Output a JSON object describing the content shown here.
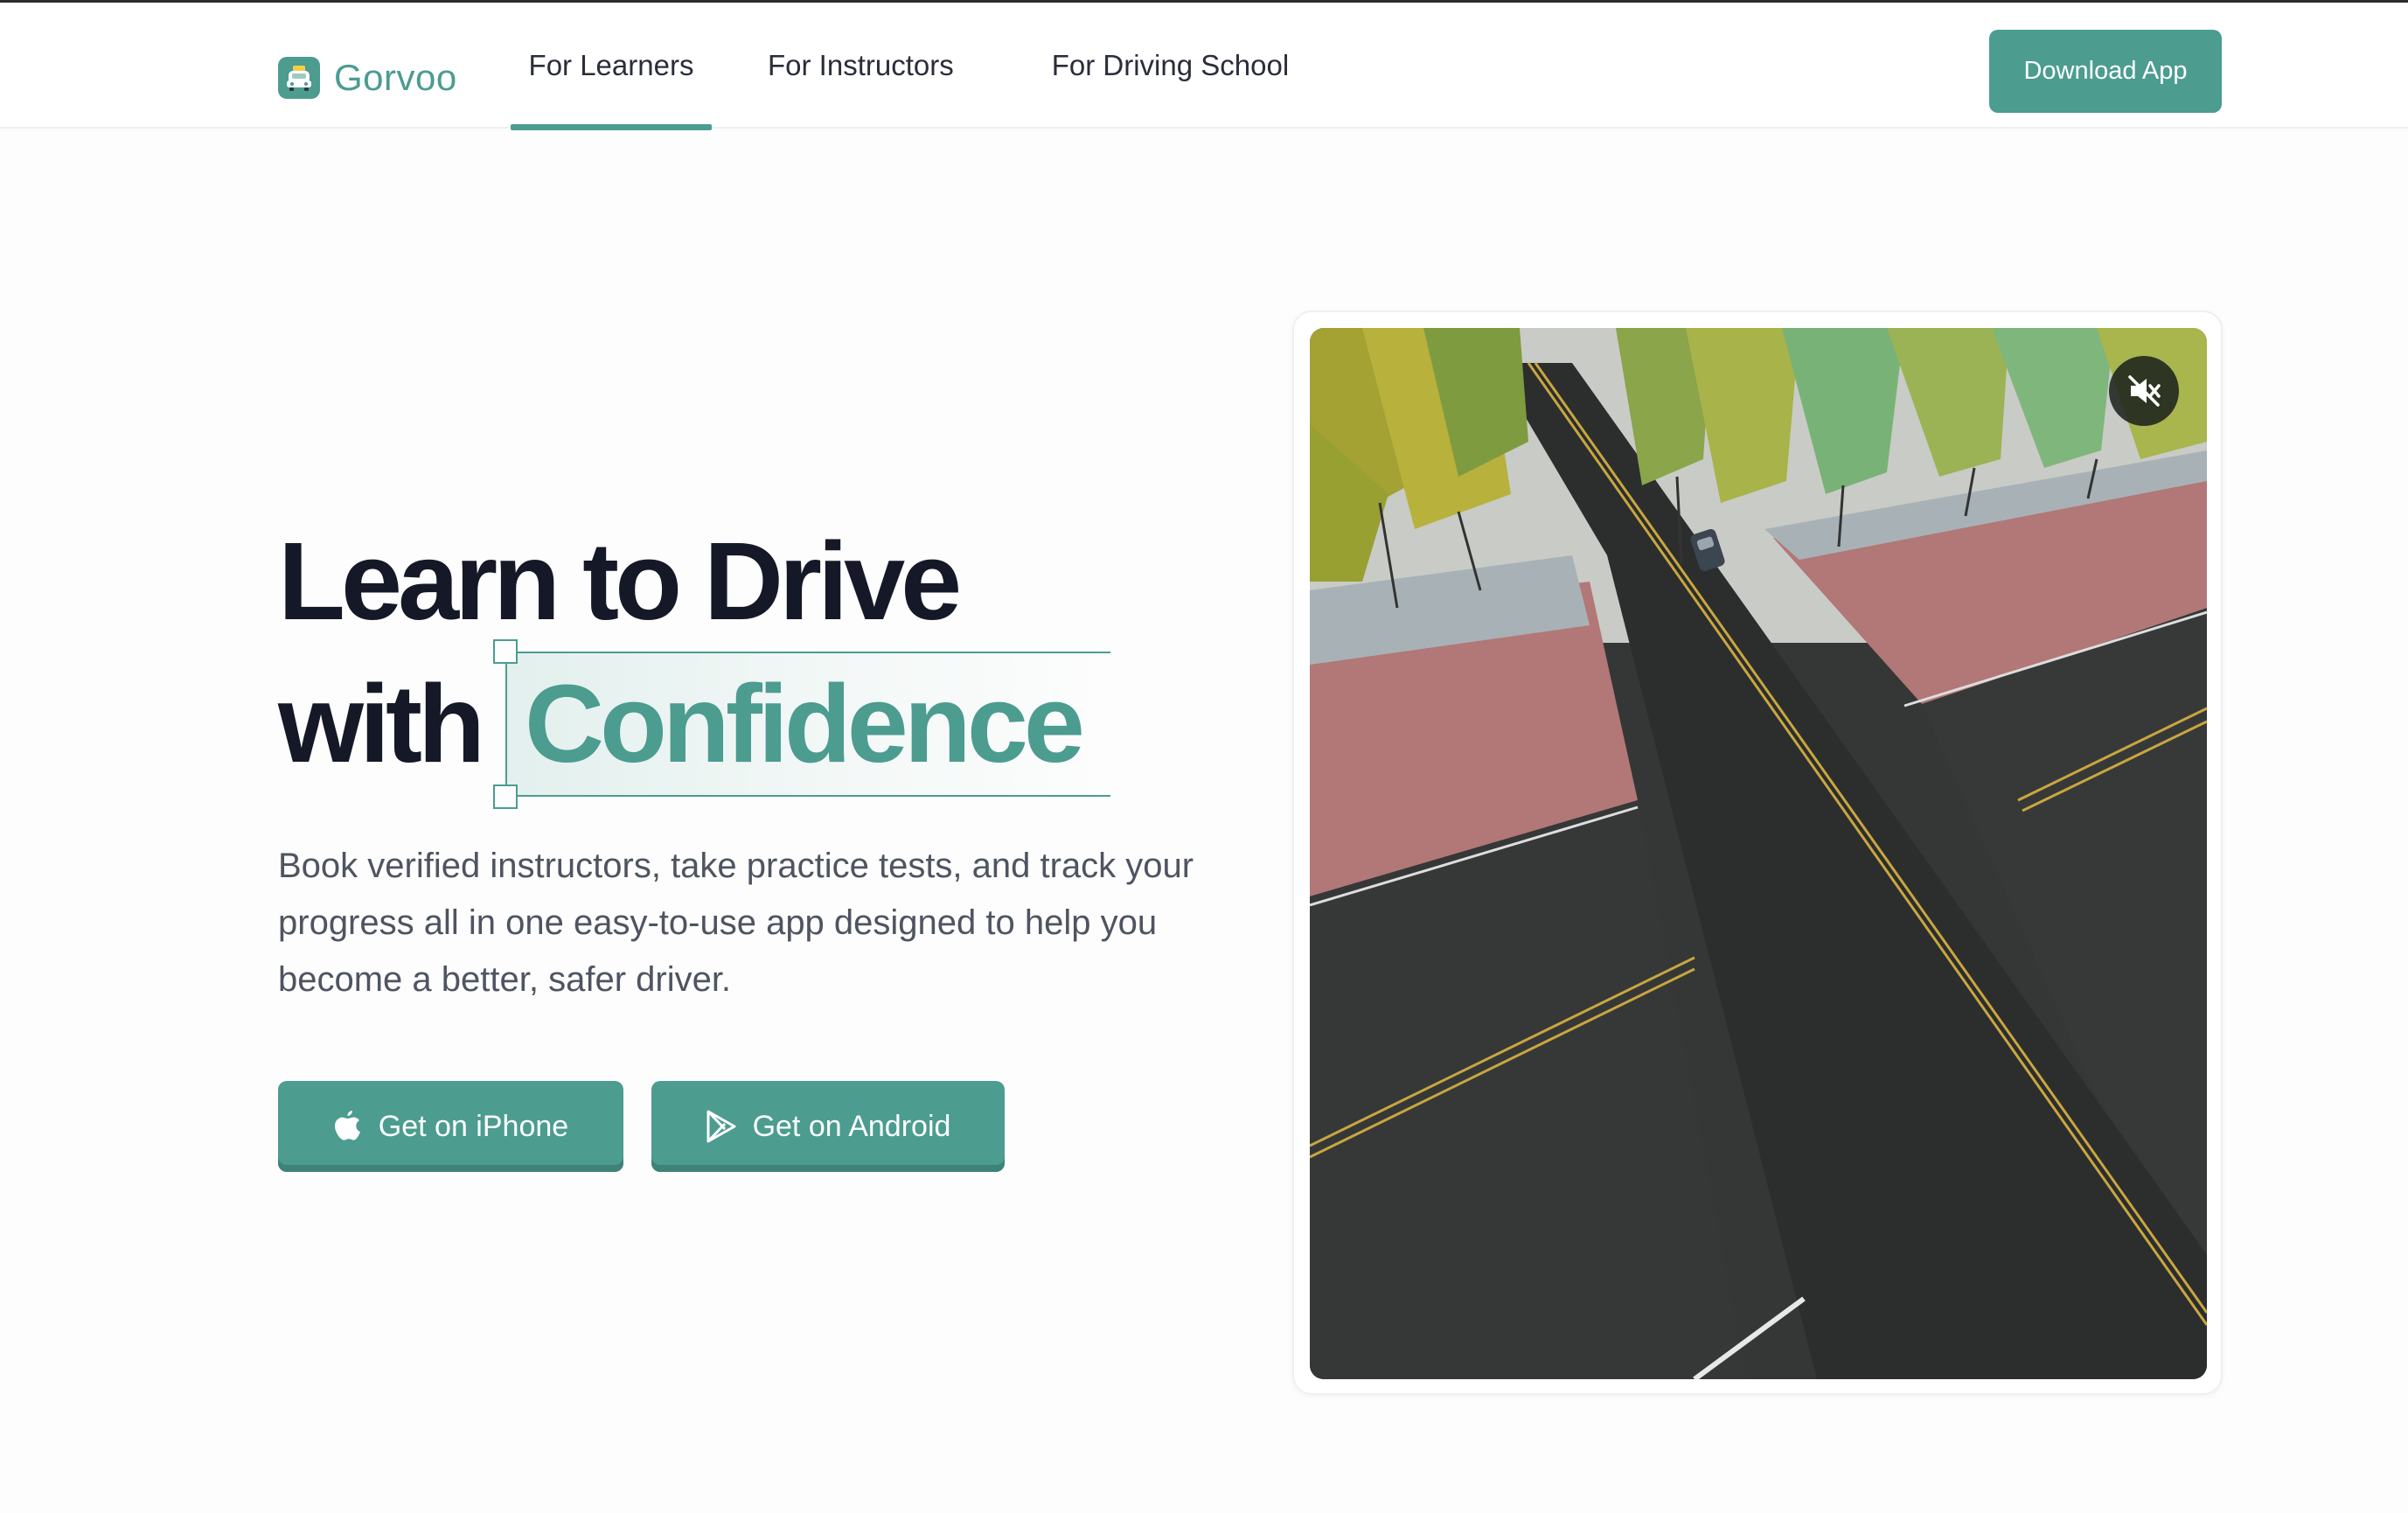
{
  "brand": {
    "name": "Gorvoo",
    "accent": "#4c9c90"
  },
  "nav": {
    "items": [
      {
        "label": "For Learners",
        "active": true
      },
      {
        "label": "For Instructors",
        "active": false
      },
      {
        "label": "For Driving School",
        "active": false
      }
    ],
    "cta_label": "Download App"
  },
  "hero": {
    "headline_line1": "Learn to Drive",
    "headline_with": "with",
    "headline_highlight": "Confidence",
    "description": "Book verified instructors, take practice tests, and track your progress all in one easy-to-use app designed to help you become a better, safer driver.",
    "iphone_label": "Get on iPhone",
    "android_label": "Get on Android",
    "iphone_icon": "apple-icon",
    "android_icon": "google-play-icon"
  },
  "video": {
    "muted": true,
    "mute_icon": "volume-muted-icon"
  }
}
